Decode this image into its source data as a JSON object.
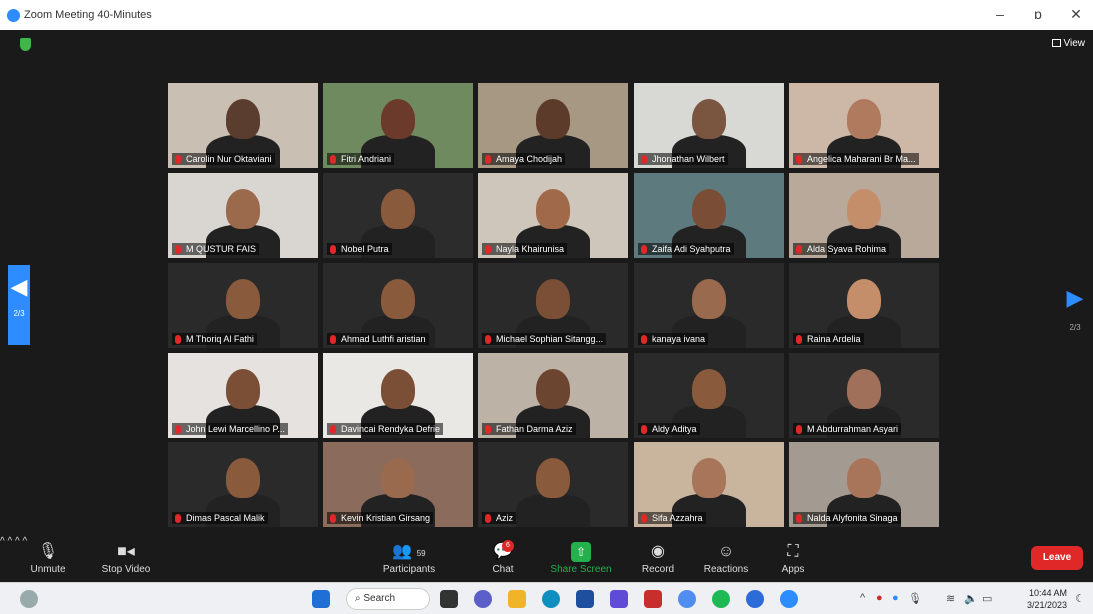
{
  "window": {
    "title": "Zoom Meeting 40-Minutes",
    "minimize": "–",
    "restore": "ɒ",
    "close": "✕"
  },
  "header": {
    "view_label": "View"
  },
  "navigation": {
    "page_left": "2/3",
    "page_right": "2/3",
    "left_arrow": "◀",
    "right_arrow": "▶"
  },
  "participants": [
    {
      "name": "Carolin Nur Oktaviani"
    },
    {
      "name": "Fitri Andriani"
    },
    {
      "name": "Amaya Chodijah"
    },
    {
      "name": "Jhonathan Wilbert"
    },
    {
      "name": "Angelica Maharani Br Ma..."
    },
    {
      "name": "M QUSTUR FAIS"
    },
    {
      "name": "Nobel Putra"
    },
    {
      "name": "Nayla Khairunisa"
    },
    {
      "name": "Zaifa Adi Syahputra"
    },
    {
      "name": "Alda Syava Rohima"
    },
    {
      "name": "M Thoriq Al Fathi"
    },
    {
      "name": "Ahmad Luthfi aristian"
    },
    {
      "name": "Michael Sophian Sitangg..."
    },
    {
      "name": "kanaya ivana"
    },
    {
      "name": "Raina Ardelia"
    },
    {
      "name": "John Lewi Marcellino P..."
    },
    {
      "name": "Davincai Rendyka Defrie"
    },
    {
      "name": "Fathan Darma Aziz"
    },
    {
      "name": "Aldy Aditya"
    },
    {
      "name": "M Abdurrahman Asyari"
    },
    {
      "name": "Dimas Pascal Malik"
    },
    {
      "name": "Kevin Kristian Girsang"
    },
    {
      "name": "Aziz"
    },
    {
      "name": "Sifa Azzahra"
    },
    {
      "name": "Nalda Alyfonita Sinaga"
    }
  ],
  "toolbar": {
    "unmute": "Unmute",
    "stop_video": "Stop Video",
    "participants": "Participants",
    "participants_count": "59",
    "chat": "Chat",
    "chat_badge": "6",
    "share_screen": "Share Screen",
    "record": "Record",
    "reactions": "Reactions",
    "apps": "Apps",
    "leave": "Leave"
  },
  "taskbar": {
    "search": "Search",
    "time": "10:44 AM",
    "date": "3/21/2023"
  },
  "colors": {
    "accent": "#2d8cff",
    "leave": "#e02828",
    "share": "#22b14c"
  }
}
